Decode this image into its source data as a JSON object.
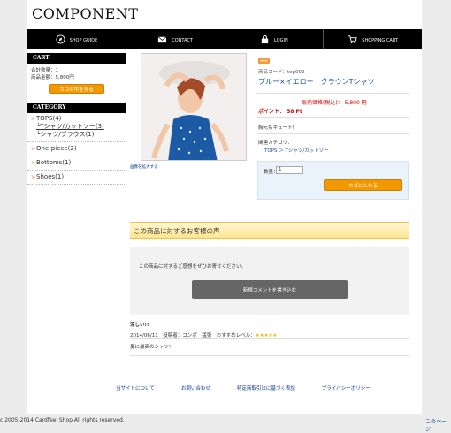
{
  "site": {
    "logo": "COMPONENT"
  },
  "nav": [
    {
      "label": "SHOP GUIDE",
      "icon": "compass-icon"
    },
    {
      "label": "CONTACT",
      "icon": "mail-icon"
    },
    {
      "label": "LOGIN",
      "icon": "lock-icon"
    },
    {
      "label": "SHOPPING CART",
      "icon": "cart-icon"
    }
  ],
  "cart": {
    "heading": "CART",
    "total_count": "合計数量：1",
    "total_amount": "商品金額：5,800円",
    "view_button": "カゴの中を見る"
  },
  "category": {
    "heading": "CATEGORY",
    "items": [
      {
        "label": "TOPS(4)"
      },
      {
        "label": "Tシャツ/カットソー(3)"
      },
      {
        "label": "シャツ/ブラウス(1)"
      },
      {
        "label": "One-piece(2)"
      },
      {
        "label": "Bottoms(1)"
      },
      {
        "label": "Shoes(1)"
      }
    ]
  },
  "product": {
    "enlarge_link": "画像を拡大する",
    "badge": "NEW",
    "code": "商品コード：top002",
    "title": "ブルー×イエロー　クラウンTシャツ",
    "price": "販売価格(税込)： 5,800 円",
    "point": "ポイント： 58 Pt",
    "description": "胸元もキュート!",
    "related_heading": "関連カテゴリ：",
    "related_path": "TOPS ＞ Tシャツ/カットソー",
    "qty_label": "数量：",
    "qty_value": "1",
    "add_to_cart": "カゴに入れる"
  },
  "reviews": {
    "heading": "この商品に対するお客様の声",
    "prompt": "この商品に対するご感想をぜひお寄せください。",
    "write_button": "新規コメントを書き込む",
    "items": [
      {
        "title": "涼しい!!",
        "meta": "2014/06/11　投稿者：コンポ　猛張　おすすめレベル：",
        "stars": "★★★★★",
        "body": "夏に最高のシャツ!"
      }
    ]
  },
  "footer": {
    "links": [
      "当サイトについて",
      "お問い合わせ",
      "特定商取引法に基づく表記",
      "プライバシーポリシー"
    ],
    "copyright": "c 2005-2014  Cardfeel Shop All rights reserved.",
    "next": "このページ"
  }
}
